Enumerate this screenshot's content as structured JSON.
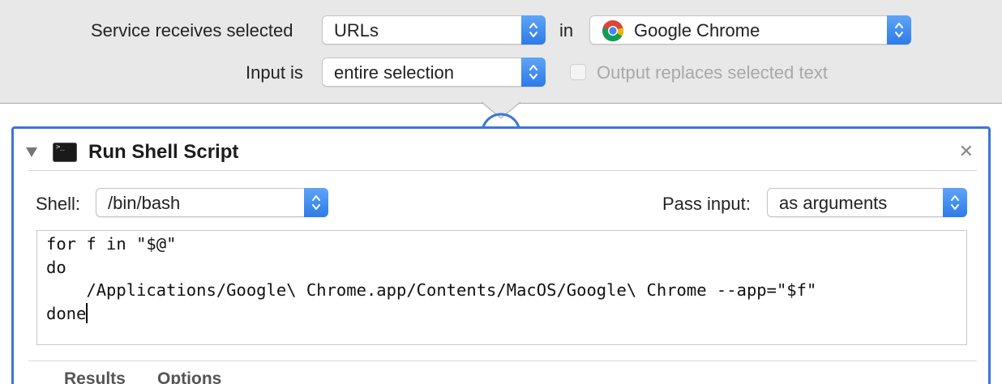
{
  "service_bar": {
    "receives_label": "Service receives selected",
    "receives_value": "URLs",
    "in_label": "in",
    "app_value": "Google Chrome",
    "app_icon": "chrome-logo",
    "input_label": "Input is",
    "input_value": "entire selection",
    "output_replaces_label": "Output replaces selected text",
    "output_replaces_checked": false
  },
  "action": {
    "icon": "terminal-icon",
    "title": "Run Shell Script",
    "close_icon": "close-icon",
    "shell_label": "Shell:",
    "shell_value": "/bin/bash",
    "pass_input_label": "Pass input:",
    "pass_input_value": "as arguments",
    "script_lines": [
      "for f in \"$@\"",
      "do",
      "    /Applications/Google\\ Chrome.app/Contents/MacOS/Google\\ Chrome --app=\"$f\"",
      "done"
    ],
    "tabs": {
      "results": "Results",
      "options": "Options"
    }
  },
  "colors": {
    "accent_blue": "#3b77d6",
    "stepper_blue": "#2e7be8",
    "toolbar_bg": "#e8e8e8"
  }
}
